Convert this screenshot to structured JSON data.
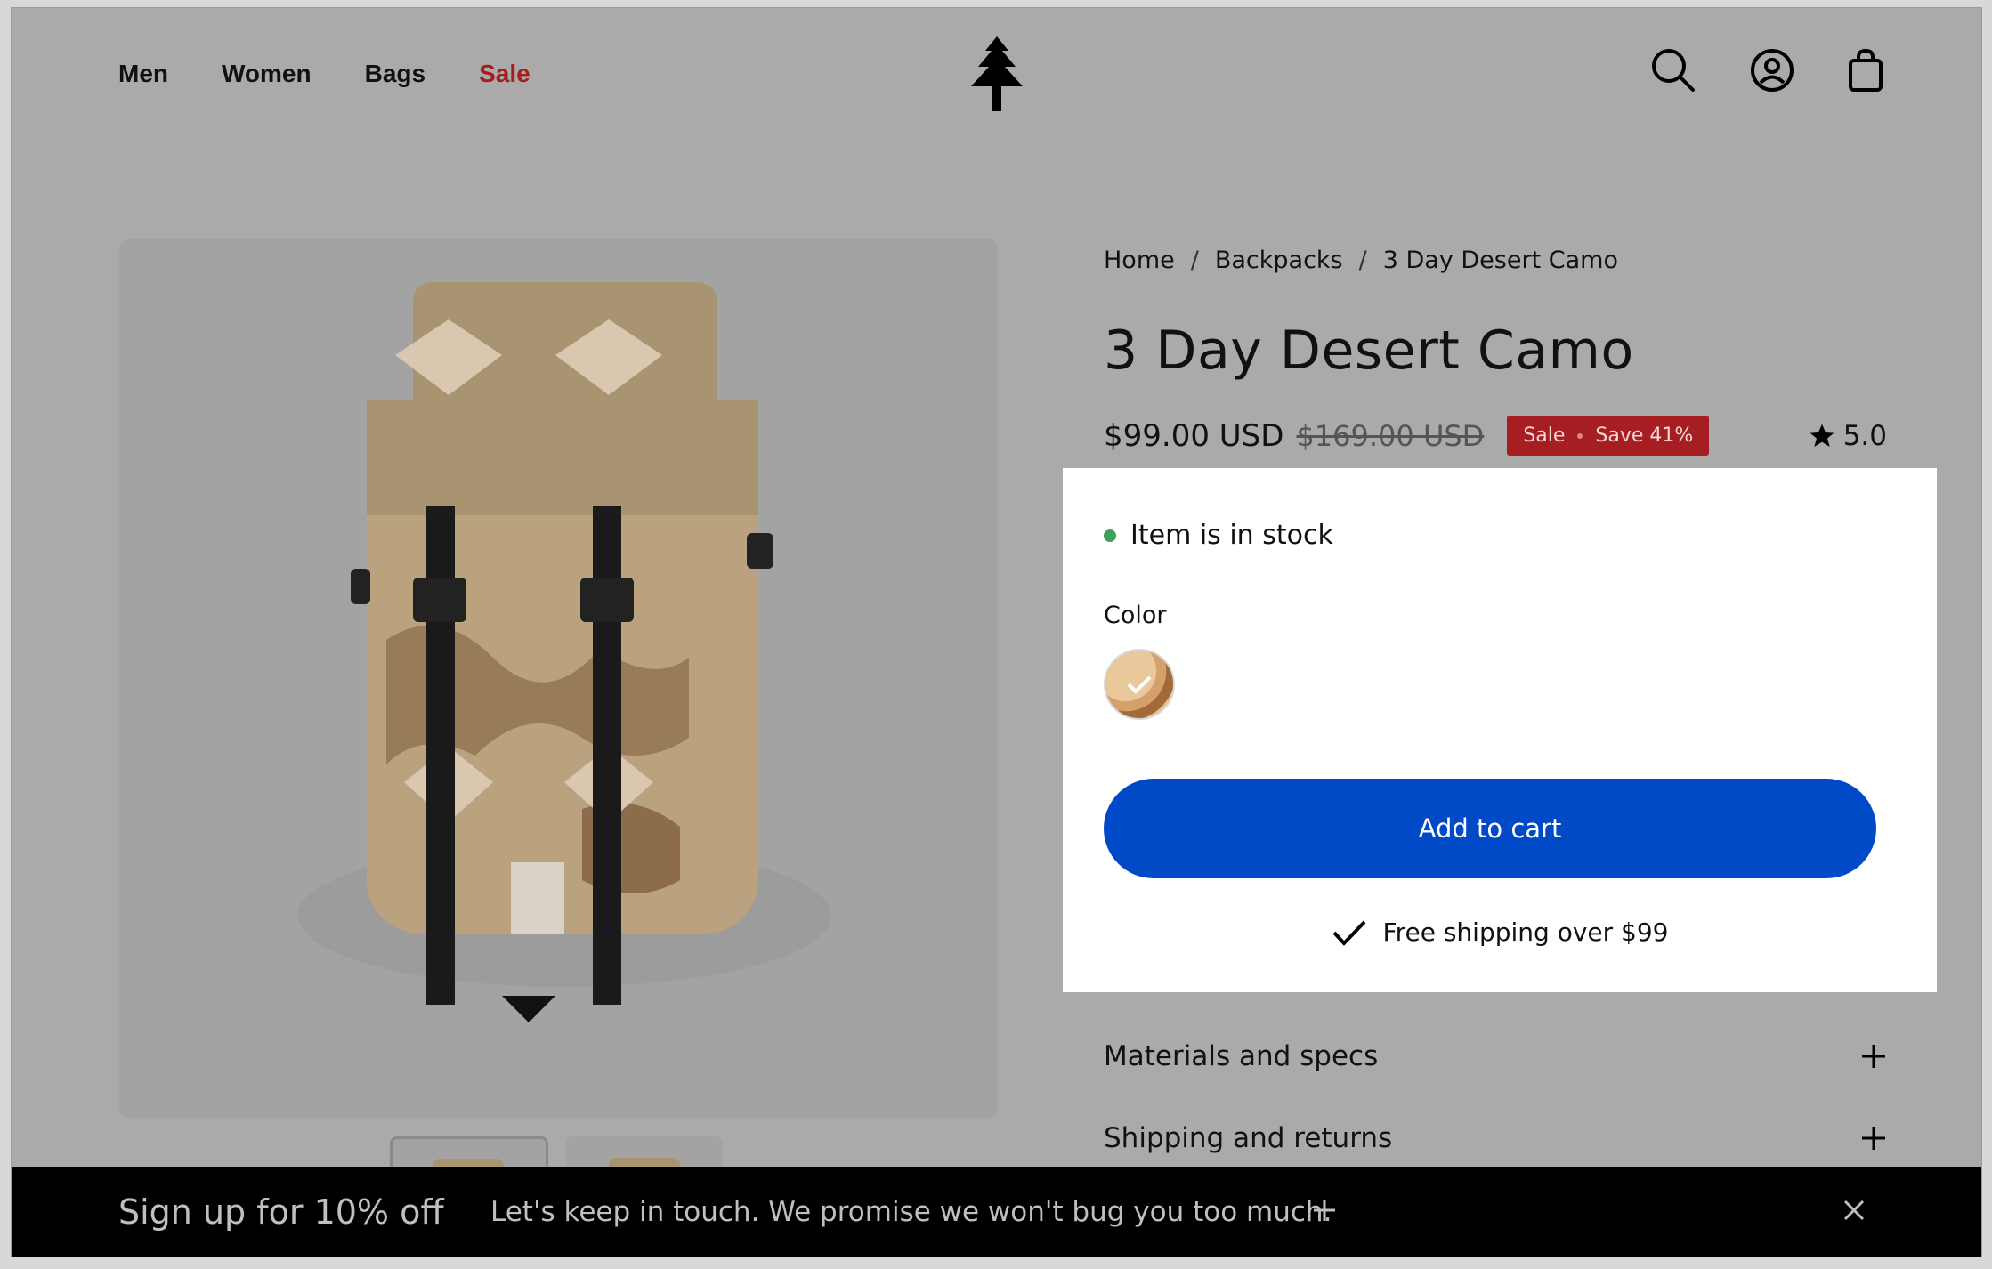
{
  "header": {
    "nav": [
      {
        "label": "Men"
      },
      {
        "label": "Women"
      },
      {
        "label": "Bags"
      },
      {
        "label": "Sale"
      }
    ],
    "logo_icon": "tree-logo-icon",
    "icons": [
      "search-icon",
      "account-icon",
      "cart-icon"
    ]
  },
  "breadcrumb": [
    "Home",
    "Backpacks",
    "3 Day Desert Camo"
  ],
  "breadcrumb_separator": "/",
  "product": {
    "title": "3 Day Desert Camo",
    "price": "$99.00 USD",
    "compare_price": "$169.00 USD",
    "badge_sale": "Sale",
    "badge_save": "Save 41%",
    "rating": "5.0",
    "stock_text": "Item is in stock",
    "color_label": "Color",
    "add_to_cart": "Add to cart",
    "shipping_note": "Free shipping over $99"
  },
  "accordions": [
    {
      "label": "Materials and specs"
    },
    {
      "label": "Shipping and returns"
    }
  ],
  "promo_bar": {
    "title": "Sign up for 10% off",
    "message": "Let's keep in touch. We promise we won't bug you too much."
  },
  "colors": {
    "accent_blue": "#0049c7",
    "sale_red": "#a41e1e",
    "stock_green": "#3ea35a"
  }
}
